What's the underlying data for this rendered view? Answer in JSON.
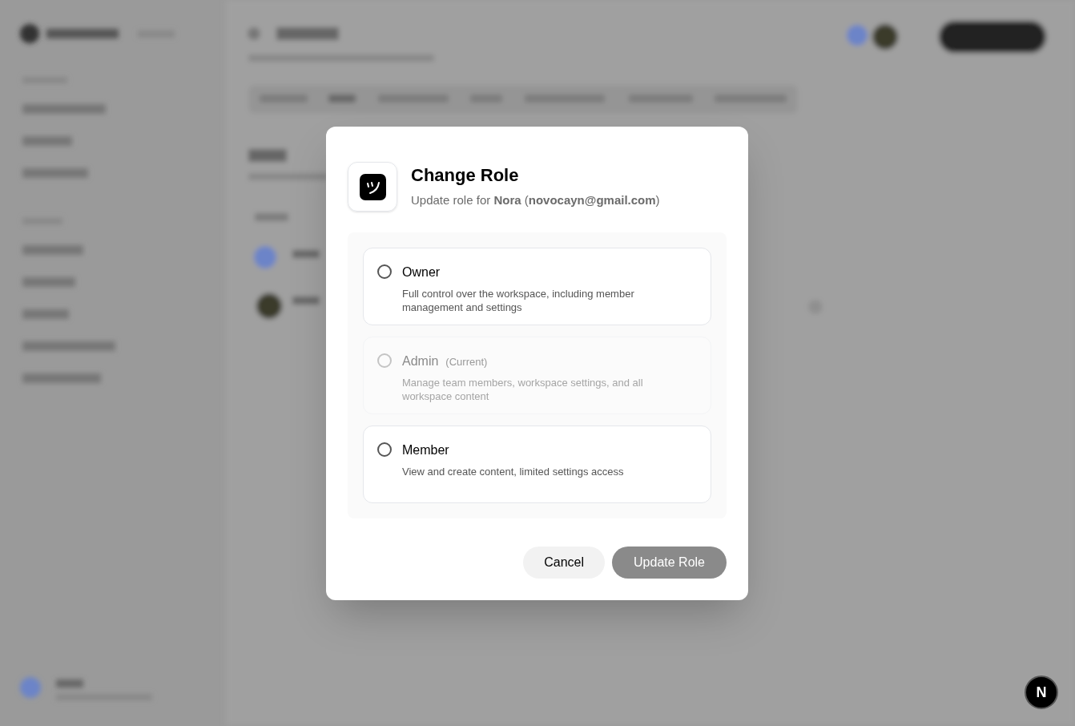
{
  "dialog": {
    "title": "Change Role",
    "subtitle": "Update role for **Nora** (**novocayn@gmail.com**)",
    "options": [
      {
        "label": "Owner",
        "description": "Full control over the workspace, including member management and settings",
        "selected": false,
        "disabled": false
      },
      {
        "label": "Admin",
        "badge": "(Current)",
        "description": "Manage team members, workspace settings, and all workspace content",
        "selected": false,
        "disabled": true
      },
      {
        "label": "Member",
        "description": "View and create content, limited settings access",
        "selected": false,
        "disabled": false
      }
    ],
    "buttons": [
      {
        "label": "Cancel",
        "kind": "secondary",
        "disabled": false
      },
      {
        "label": "Update Role",
        "kind": "primary",
        "disabled": true
      }
    ]
  },
  "dev_indicator": {
    "label": "N"
  }
}
